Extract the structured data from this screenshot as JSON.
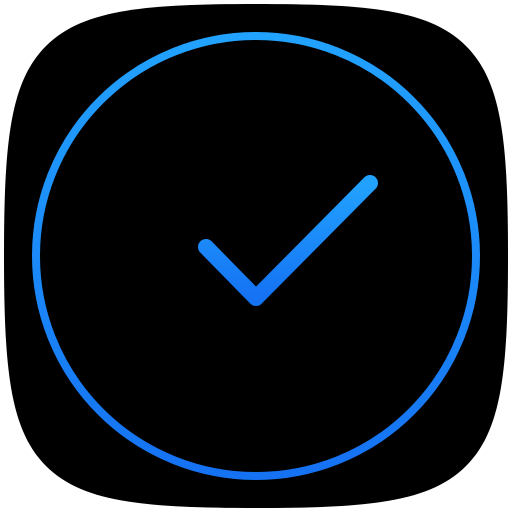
{
  "app_icon": {
    "name": "checkmark-clock-app-icon",
    "background_color": "#000000",
    "gradient_top": "#22A2FF",
    "gradient_bottom": "#1572F3",
    "glyph": "check-in-ring"
  }
}
